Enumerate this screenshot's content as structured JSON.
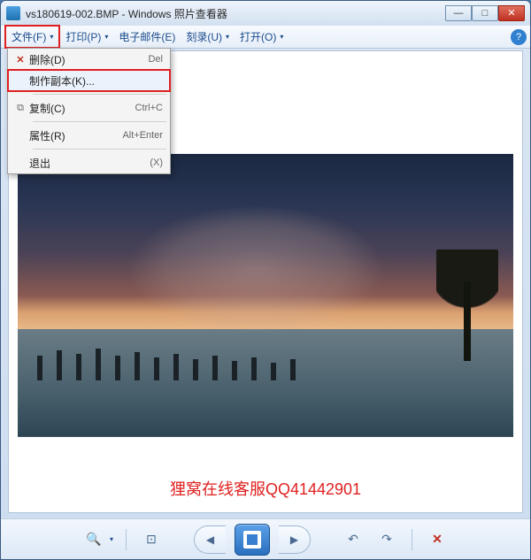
{
  "window": {
    "title": "vs180619-002.BMP - Windows 照片查看器"
  },
  "menubar": {
    "items": [
      {
        "label": "文件(F)",
        "active": true
      },
      {
        "label": "打印(P)",
        "active": false
      },
      {
        "label": "电子邮件(E)",
        "active": false
      },
      {
        "label": "刻录(U)",
        "active": false
      },
      {
        "label": "打开(O)",
        "active": false
      }
    ]
  },
  "dropdown": {
    "items": [
      {
        "icon": "x",
        "label": "删除(D)",
        "shortcut": "Del",
        "highlighted": false
      },
      {
        "icon": "",
        "label": "制作副本(K)...",
        "shortcut": "",
        "highlighted": true
      },
      {
        "divider": true
      },
      {
        "icon": "copy",
        "label": "复制(C)",
        "shortcut": "Ctrl+C",
        "highlighted": false
      },
      {
        "divider": true
      },
      {
        "icon": "",
        "label": "属性(R)",
        "shortcut": "Alt+Enter",
        "highlighted": false
      },
      {
        "divider": true
      },
      {
        "icon": "",
        "label": "退出",
        "shortcut": "(X)",
        "highlighted": false
      }
    ]
  },
  "caption": "狸窝在线客服QQ41442901",
  "icons": {
    "minimize": "—",
    "maximize": "□",
    "close": "✕",
    "help": "?",
    "caret": "▾",
    "zoom": "🔍",
    "fit": "⊡",
    "prev": "◀",
    "next": "▶",
    "rotleft": "↶",
    "rotright": "↷",
    "delete": "✕",
    "copy": "⧉"
  },
  "colors": {
    "accent_red": "#e02020",
    "link_blue": "#1a4b8c"
  }
}
